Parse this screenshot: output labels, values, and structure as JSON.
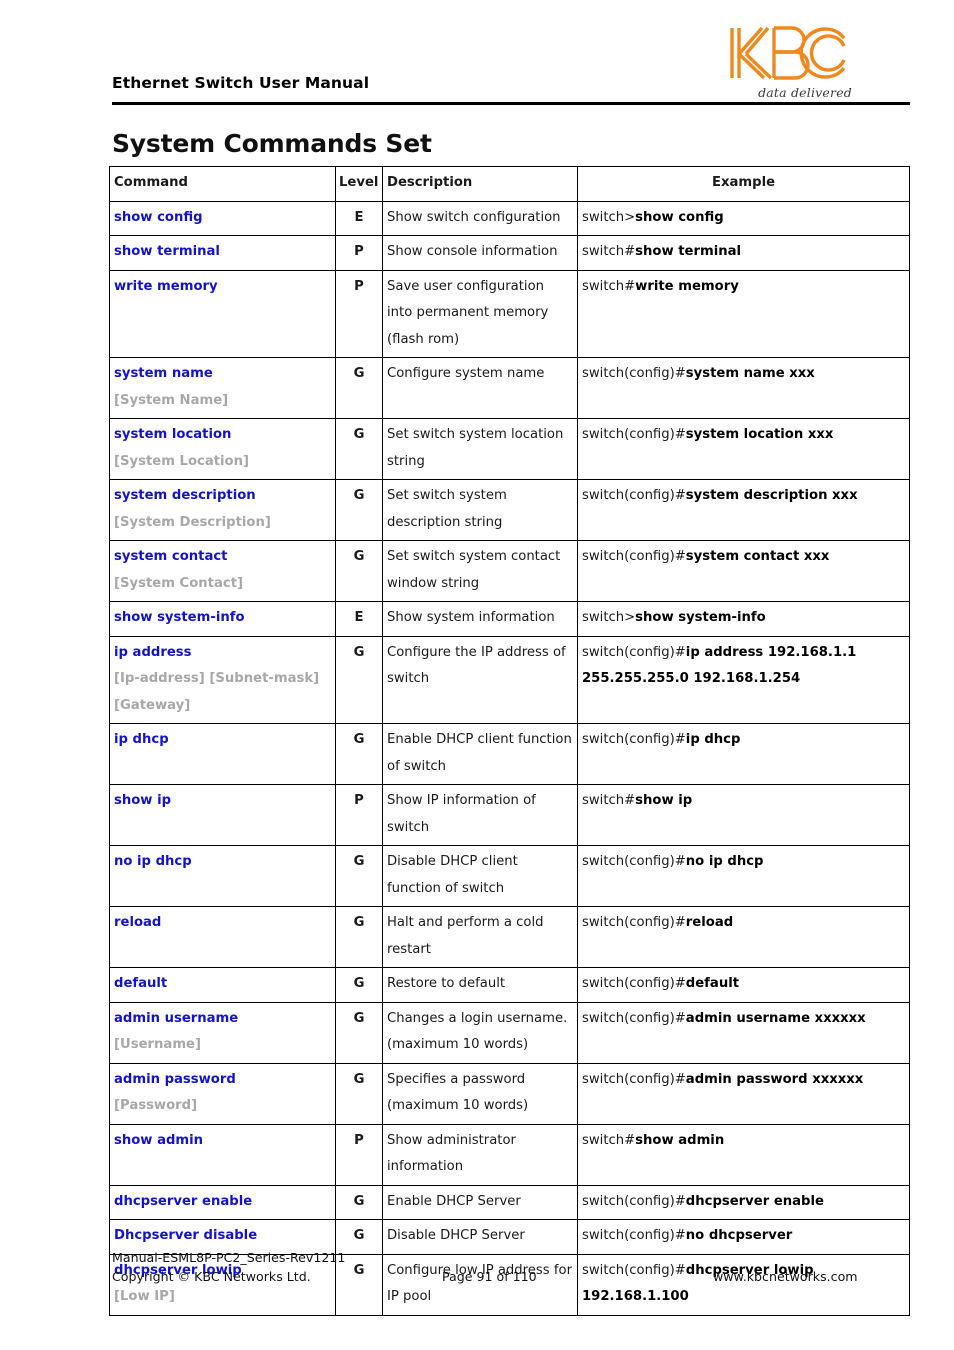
{
  "header": {
    "running_title": "Ethernet Switch User Manual",
    "logo_text": "KBC",
    "logo_tagline": "data delivered",
    "logo_color": "#F0881E"
  },
  "page_title": "System Commands Set",
  "table": {
    "columns": [
      "Command",
      "Level",
      "Description",
      "Example"
    ],
    "header_color": "#F2881C",
    "command_color": "#1313CE",
    "param_color": "#A8A8A8",
    "rows": [
      {
        "command": "show config",
        "param": "",
        "level": "E",
        "description": "Show switch configuration",
        "example_prompt": "switch>",
        "example_command": "show config",
        "example_line2": ""
      },
      {
        "command": "show terminal",
        "param": "",
        "level": "P",
        "description": "Show console information",
        "example_prompt": "switch#",
        "example_command": "show terminal",
        "example_line2": ""
      },
      {
        "command": "write memory",
        "param": "",
        "level": "P",
        "description": "Save user configuration into permanent memory (flash rom)",
        "example_prompt": "switch#",
        "example_command": "write memory",
        "example_line2": ""
      },
      {
        "command": "system name",
        "param": "[System Name]",
        "level": "G",
        "description": "Configure system name",
        "example_prompt": "switch(config)#",
        "example_command": "system name xxx",
        "example_line2": ""
      },
      {
        "command": "system location",
        "param": "[System Location]",
        "level": "G",
        "description": "Set switch system location string",
        "example_prompt": "switch(config)#",
        "example_command": "system location xxx",
        "example_line2": ""
      },
      {
        "command": "system description",
        "param": "[System Description]",
        "level": "G",
        "description": "Set switch system description string",
        "example_prompt": "switch(config)#",
        "example_command": "system description xxx",
        "example_line2": ""
      },
      {
        "command": "system contact",
        "param": "[System Contact]",
        "level": "G",
        "description": "Set switch system contact window string",
        "example_prompt": "switch(config)#",
        "example_command": "system contact xxx",
        "example_line2": ""
      },
      {
        "command": "show system-info",
        "param": "",
        "level": "E",
        "description": "Show system information",
        "example_prompt": "switch>",
        "example_command": "show system-info",
        "example_line2": ""
      },
      {
        "command": "ip address",
        "param": "[Ip-address] [Subnet-mask] [Gateway]",
        "level": "G",
        "description": "Configure the IP address of switch",
        "example_prompt": "switch(config)#",
        "example_command": "ip address 192.168.1.1",
        "example_line2": "255.255.255.0 192.168.1.254"
      },
      {
        "command": "ip dhcp",
        "param": "",
        "level": "G",
        "description": "Enable DHCP client function of switch",
        "example_prompt": "switch(config)#",
        "example_command": "ip dhcp",
        "example_line2": ""
      },
      {
        "command": "show ip",
        "param": "",
        "level": "P",
        "description": "Show IP information of switch",
        "example_prompt": "switch#",
        "example_command": "show ip",
        "example_line2": ""
      },
      {
        "command": "no ip dhcp",
        "param": "",
        "level": "G",
        "description": "Disable DHCP client function of switch",
        "example_prompt": "switch(config)#",
        "example_command": "no ip dhcp",
        "example_line2": ""
      },
      {
        "command": "reload",
        "param": "",
        "level": "G",
        "description": "Halt and perform a cold restart",
        "example_prompt": "switch(config)#",
        "example_command": "reload",
        "example_line2": ""
      },
      {
        "command": "default",
        "param": "",
        "level": "G",
        "description": "Restore to default",
        "example_prompt": "switch(config)#",
        "example_command": "default",
        "example_line2": ""
      },
      {
        "command": "admin username",
        "param": "[Username]",
        "level": "G",
        "description": "Changes a login username. (maximum 10 words)",
        "example_prompt": "switch(config)#",
        "example_command": "admin username xxxxxx",
        "example_line2": ""
      },
      {
        "command": "admin password",
        "param": "[Password]",
        "level": "G",
        "description": "Specifies a password (maximum 10 words)",
        "example_prompt": "switch(config)#",
        "example_command": "admin password xxxxxx",
        "example_line2": ""
      },
      {
        "command": "show admin",
        "param": "",
        "level": "P",
        "description": "Show administrator information",
        "example_prompt": "switch#",
        "example_command": "show admin",
        "example_line2": ""
      },
      {
        "command": "dhcpserver enable",
        "param": "",
        "level": "G",
        "description": "Enable DHCP Server",
        "example_prompt": "switch(config)#",
        "example_command": "dhcpserver enable",
        "example_line2": ""
      },
      {
        "command": "Dhcpserver disable",
        "param": "",
        "level": "G",
        "description": "Disable DHCP Server",
        "example_prompt": "switch(config)#",
        "example_command": "no dhcpserver",
        "example_line2": ""
      },
      {
        "command": "dhcpserver lowip",
        "param": "[Low IP]",
        "level": "G",
        "description": "Configure low IP address for IP pool",
        "example_prompt": "switch(config)#",
        "example_command": "dhcpserver lowip",
        "example_line2": "192.168.1.100"
      }
    ]
  },
  "footer": {
    "manual_id": "Manual-ESML8P-PC2_Series-Rev1211",
    "copyright": "Copyright © KBC Networks Ltd.",
    "page_number": "Page 91 of 110",
    "website": "www.kbcnetworks.com"
  }
}
